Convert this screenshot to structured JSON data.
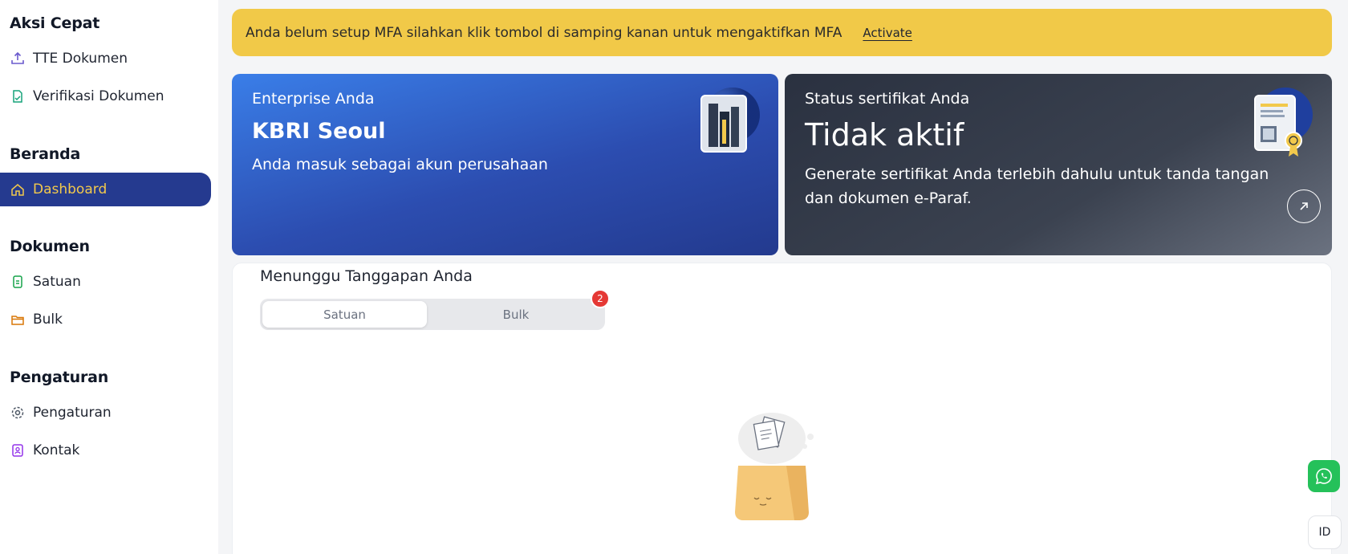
{
  "sidebar": {
    "sections": [
      {
        "title": "Aksi Cepat",
        "items": [
          {
            "label": "TTE Dokumen",
            "icon": "upload-icon"
          },
          {
            "label": "Verifikasi Dokumen",
            "icon": "file-verify-icon"
          }
        ]
      },
      {
        "title": "Beranda",
        "items": [
          {
            "label": "Dashboard",
            "icon": "home-icon",
            "active": true
          }
        ]
      },
      {
        "title": "Dokumen",
        "items": [
          {
            "label": "Satuan",
            "icon": "document-icon"
          },
          {
            "label": "Bulk",
            "icon": "folder-icon"
          }
        ]
      },
      {
        "title": "Pengaturan",
        "items": [
          {
            "label": "Pengaturan",
            "icon": "gear-icon"
          },
          {
            "label": "Kontak",
            "icon": "contact-book-icon"
          }
        ]
      }
    ]
  },
  "banner": {
    "text": "Anda belum setup MFA silahkan klik tombol di samping kanan untuk mengaktifkan MFA",
    "action": "Activate"
  },
  "enterprise_card": {
    "kicker": "Enterprise Anda",
    "name": "KBRI Seoul",
    "desc": "Anda masuk sebagai akun perusahaan"
  },
  "certificate_card": {
    "kicker": "Status sertifikat Anda",
    "status": "Tidak aktif",
    "desc": "Generate sertifikat Anda terlebih dahulu untuk tanda tangan dan dokumen e-Paraf."
  },
  "waiting": {
    "title": "Menunggu Tanggapan Anda",
    "tabs": [
      "Satuan",
      "Bulk"
    ],
    "bulk_count": "2"
  },
  "floating": {
    "lang": "ID"
  },
  "colors": {
    "accent": "#253a8f",
    "highlight": "#f2c94c",
    "banner": "#f1c948",
    "whatsapp": "#25c15a"
  }
}
